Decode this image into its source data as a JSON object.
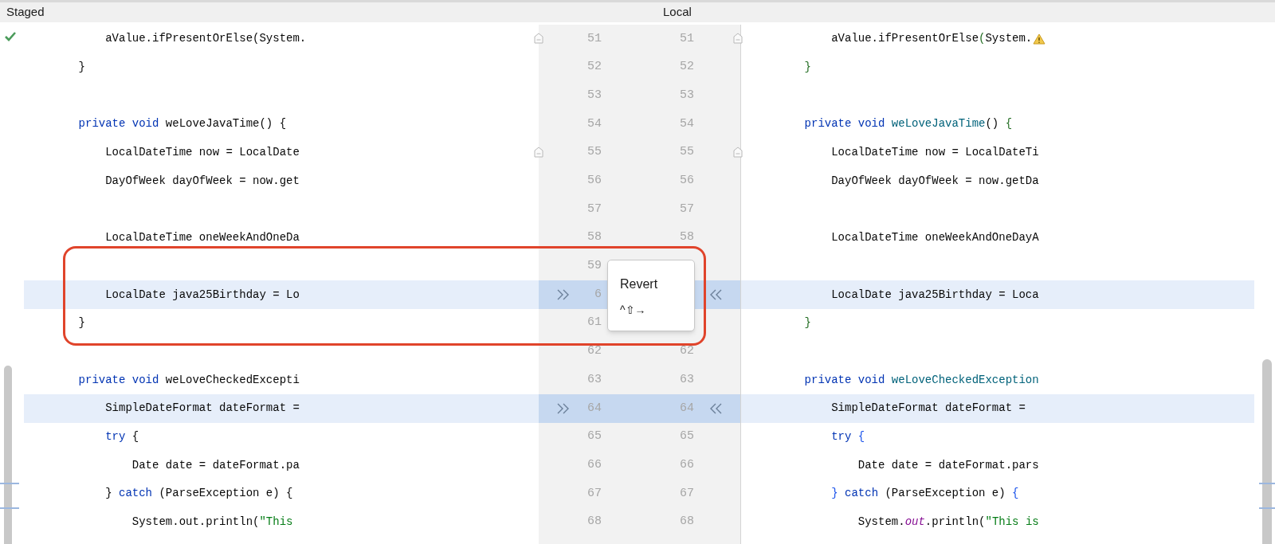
{
  "header": {
    "left_title": "Staged",
    "center_title": "Local"
  },
  "staged": true,
  "rows": [
    {
      "left_number": "51",
      "right_number": "51",
      "changed": false,
      "fold": true,
      "warning": true,
      "left_code": [
        {
          "text": "        aValue.ifPresentOrElse(System.",
          "kind": "plain"
        }
      ],
      "right_code": [
        {
          "text": "        aValue.ifPresentOrElse",
          "kind": "plain"
        },
        {
          "text": "(",
          "kind": "bracket_green"
        },
        {
          "text": "System.",
          "kind": "plain"
        }
      ]
    },
    {
      "left_number": "52",
      "right_number": "52",
      "changed": false,
      "fold": false,
      "left_code": [
        {
          "text": "    }",
          "kind": "plain"
        }
      ],
      "right_code": [
        {
          "text": "    }",
          "kind": "bracket_green"
        }
      ]
    },
    {
      "left_number": "53",
      "right_number": "53",
      "changed": false,
      "fold": false
    },
    {
      "left_number": "54",
      "right_number": "54",
      "changed": false,
      "fold": false,
      "left_code": [
        {
          "text": "    private void",
          "kind": "keyword"
        },
        {
          "text": " weLoveJavaTime() {",
          "kind": "plain"
        }
      ],
      "right_code": [
        {
          "text": "    private void ",
          "kind": "keyword"
        },
        {
          "text": "weLoveJavaTime",
          "kind": "method"
        },
        {
          "text": "() ",
          "kind": "plain"
        },
        {
          "text": "{",
          "kind": "bracket_green"
        }
      ]
    },
    {
      "left_number": "55",
      "right_number": "55",
      "changed": false,
      "fold": true,
      "left_code": [
        {
          "text": "        LocalDateTime now = LocalDate",
          "kind": "plain"
        }
      ],
      "right_code": [
        {
          "text": "        LocalDateTime now = LocalDateTi",
          "kind": "plain"
        }
      ]
    },
    {
      "left_number": "56",
      "right_number": "56",
      "changed": false,
      "fold": false,
      "left_code": [
        {
          "text": "        DayOfWeek dayOfWeek = now.get",
          "kind": "plain"
        }
      ],
      "right_code": [
        {
          "text": "        DayOfWeek dayOfWeek = now.getDa",
          "kind": "plain"
        }
      ]
    },
    {
      "left_number": "57",
      "right_number": "57",
      "changed": false,
      "fold": false
    },
    {
      "left_number": "58",
      "right_number": "58",
      "changed": false,
      "fold": false,
      "left_code": [
        {
          "text": "        LocalDateTime oneWeekAndOneDa",
          "kind": "plain"
        }
      ],
      "right_code": [
        {
          "text": "        LocalDateTime oneWeekAndOneDayA",
          "kind": "plain"
        }
      ]
    },
    {
      "left_number": "59",
      "changed": false,
      "fold": false
    },
    {
      "left_number": "6",
      "changed": true,
      "fold": false,
      "left_code": [
        {
          "text": "        LocalDate java25Birthday = Lo",
          "kind": "plain"
        }
      ],
      "right_code": [
        {
          "text": "        LocalDate java25Birthday = Loca",
          "kind": "plain"
        }
      ]
    },
    {
      "left_number": "61",
      "changed": false,
      "fold": false,
      "left_code": [
        {
          "text": "    }",
          "kind": "plain"
        }
      ],
      "right_code": [
        {
          "text": "    }",
          "kind": "bracket_green"
        }
      ]
    },
    {
      "left_number": "62",
      "right_number": "62",
      "changed": false,
      "fold": false
    },
    {
      "left_number": "63",
      "right_number": "63",
      "changed": false,
      "fold": false,
      "left_code": [
        {
          "text": "    private void",
          "kind": "keyword"
        },
        {
          "text": " weLoveCheckedExcepti",
          "kind": "plain"
        }
      ],
      "right_code": [
        {
          "text": "    private void ",
          "kind": "keyword"
        },
        {
          "text": "weLoveCheckedException",
          "kind": "method"
        }
      ]
    },
    {
      "left_number": "64",
      "right_number": "64",
      "changed": true,
      "fold": false,
      "left_code": [
        {
          "text": "        SimpleDateFormat dateFormat =",
          "kind": "plain"
        }
      ],
      "right_code": [
        {
          "text": "        SimpleDateFormat dateFormat =",
          "kind": "plain"
        }
      ]
    },
    {
      "left_number": "65",
      "right_number": "65",
      "changed": false,
      "fold": false,
      "left_code": [
        {
          "text": "        try",
          "kind": "keyword"
        },
        {
          "text": " {",
          "kind": "plain"
        }
      ],
      "right_code": [
        {
          "text": "        try ",
          "kind": "keyword"
        },
        {
          "text": "{",
          "kind": "bracket_blue"
        }
      ]
    },
    {
      "left_number": "66",
      "right_number": "66",
      "changed": false,
      "fold": false,
      "left_code": [
        {
          "text": "            Date date = dateFormat.pa",
          "kind": "plain"
        }
      ],
      "right_code": [
        {
          "text": "            Date date = dateFormat.pars",
          "kind": "plain"
        }
      ]
    },
    {
      "left_number": "67",
      "right_number": "67",
      "changed": false,
      "fold": false,
      "left_code": [
        {
          "text": "        } ",
          "kind": "plain"
        },
        {
          "text": "catch",
          "kind": "keyword"
        },
        {
          "text": " (ParseException e) {",
          "kind": "plain"
        }
      ],
      "right_code": [
        {
          "text": "        }",
          "kind": "bracket_blue"
        },
        {
          "text": " catch",
          "kind": "keyword"
        },
        {
          "text": " (ParseException e) ",
          "kind": "plain"
        },
        {
          "text": "{",
          "kind": "bracket_blue"
        }
      ]
    },
    {
      "left_number": "68",
      "right_number": "68",
      "changed": false,
      "fold": false,
      "left_code": [
        {
          "text": "            System.out.println(",
          "kind": "plain"
        },
        {
          "text": "\"This",
          "kind": "string"
        }
      ],
      "right_code": [
        {
          "text": "            System.",
          "kind": "plain"
        },
        {
          "text": "out",
          "kind": "field"
        },
        {
          "text": ".println(",
          "kind": "plain"
        },
        {
          "text": "\"This is",
          "kind": "string"
        }
      ]
    }
  ],
  "popup": {
    "title": "Revert",
    "shortcut": "^⇧→"
  }
}
